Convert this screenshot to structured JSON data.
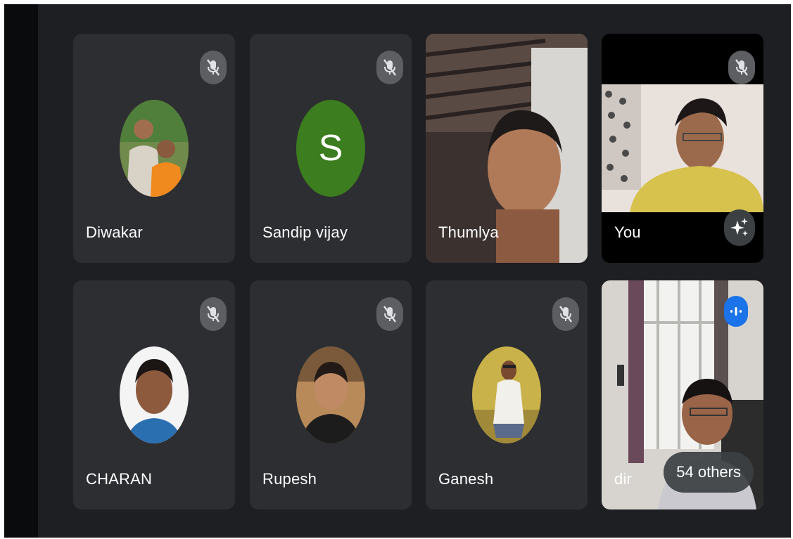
{
  "participants": [
    {
      "name": "Diwakar",
      "muted": true,
      "view": "photo-avatar"
    },
    {
      "name": "Sandip vijay",
      "muted": true,
      "view": "letter-avatar",
      "initial": "S",
      "avatar_color": "#3c7d1f"
    },
    {
      "name": "Thumlya",
      "muted": false,
      "view": "camera"
    },
    {
      "name": "You",
      "muted": true,
      "view": "camera",
      "extra_icon": "sparkle-icon"
    },
    {
      "name": "CHARAN",
      "muted": true,
      "view": "photo-avatar"
    },
    {
      "name": "Rupesh",
      "muted": true,
      "view": "photo-avatar"
    },
    {
      "name": "Ganesh",
      "muted": true,
      "view": "photo-avatar"
    },
    {
      "name": "dir",
      "muted": false,
      "view": "camera",
      "speaking": true
    }
  ],
  "others_chip": {
    "label": "54 others"
  },
  "icons": {
    "mic_off": "mic-off-icon",
    "speaking": "audio-level-icon",
    "effects": "sparkle-icon"
  },
  "colors": {
    "tile_bg": "#2d2e31",
    "stage_bg": "#1e1f22",
    "speaking_accent": "#1a73e8",
    "muted_badge": "#5d5e61"
  }
}
